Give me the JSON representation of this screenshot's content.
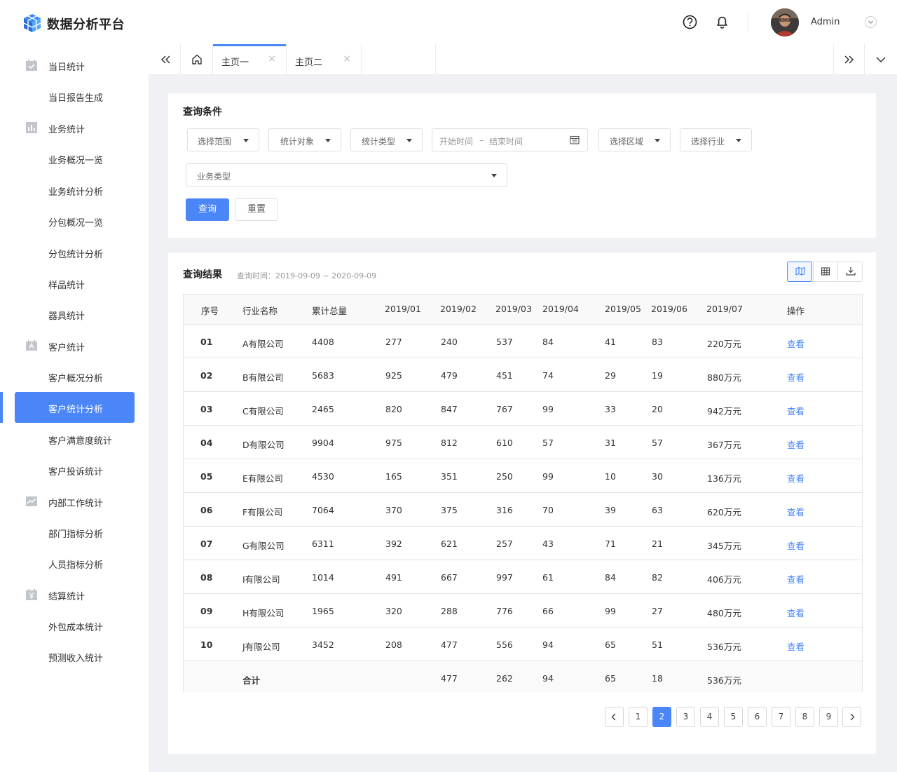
{
  "app": {
    "brand": "数据分析平台",
    "username": "Admin"
  },
  "sidebar": {
    "items": [
      {
        "label": "当日统计",
        "type": "group",
        "icon": "calendar-check-icon"
      },
      {
        "label": "当日报告生成",
        "type": "sub"
      },
      {
        "label": "业务统计",
        "type": "group",
        "icon": "bar-chart-icon"
      },
      {
        "label": "业务概况一览",
        "type": "sub"
      },
      {
        "label": "业务统计分析",
        "type": "sub"
      },
      {
        "label": "分包概况一览",
        "type": "sub"
      },
      {
        "label": "分包统计分析",
        "type": "sub"
      },
      {
        "label": "样品统计",
        "type": "sub"
      },
      {
        "label": "器具统计",
        "type": "sub"
      },
      {
        "label": "客户统计",
        "type": "group",
        "icon": "contact-card-icon"
      },
      {
        "label": "客户概况分析",
        "type": "sub"
      },
      {
        "label": "客户统计分析",
        "type": "sub",
        "active": true
      },
      {
        "label": "客户满意度统计",
        "type": "sub"
      },
      {
        "label": "客户投诉统计",
        "type": "sub"
      },
      {
        "label": "内部工作统计",
        "type": "group",
        "icon": "line-chart-icon"
      },
      {
        "label": "部门指标分析",
        "type": "sub"
      },
      {
        "label": "人员指标分析",
        "type": "sub"
      },
      {
        "label": "结算统计",
        "type": "group",
        "icon": "yen-calendar-icon"
      },
      {
        "label": "外包成本统计",
        "type": "sub"
      },
      {
        "label": "预测收入统计",
        "type": "sub"
      }
    ]
  },
  "tabs": [
    {
      "label": "主页一",
      "active": true
    },
    {
      "label": "主页二",
      "active": false
    }
  ],
  "query": {
    "title": "查询条件",
    "filters": {
      "scope": "选择范围",
      "target": "统计对象",
      "stat_type": "统计类型",
      "start": "开始时间",
      "range_sep": "–",
      "end": "结束时间",
      "region": "选择区域",
      "industry": "选择行业",
      "biz_type": "业务类型"
    },
    "buttons": {
      "search": "查询",
      "reset": "重置"
    }
  },
  "results": {
    "title": "查询结果",
    "time_label": "查询时间：2019-09-09 ~ 2020-09-09",
    "columns": [
      "序号",
      "行业名称",
      "累计总量",
      "2019/01",
      "2019/02",
      "2019/03",
      "2019/04",
      "2019/05",
      "2019/06",
      "2019/07",
      "操作"
    ],
    "rows": [
      [
        "01",
        "A有限公司",
        "4408",
        "277",
        "240",
        "537",
        "84",
        "41",
        "83",
        "220万元",
        "查看"
      ],
      [
        "02",
        "B有限公司",
        "5683",
        "925",
        "479",
        "451",
        "74",
        "29",
        "19",
        "880万元",
        "查看"
      ],
      [
        "03",
        "C有限公司",
        "2465",
        "820",
        "847",
        "767",
        "99",
        "33",
        "20",
        "942万元",
        "查看"
      ],
      [
        "04",
        "D有限公司",
        "9904",
        "975",
        "812",
        "610",
        "57",
        "31",
        "57",
        "367万元",
        "查看"
      ],
      [
        "05",
        "E有限公司",
        "4530",
        "165",
        "351",
        "250",
        "99",
        "10",
        "30",
        "136万元",
        "查看"
      ],
      [
        "06",
        "F有限公司",
        "7064",
        "370",
        "375",
        "316",
        "70",
        "39",
        "63",
        "620万元",
        "查看"
      ],
      [
        "07",
        "G有限公司",
        "6311",
        "392",
        "621",
        "257",
        "43",
        "71",
        "21",
        "345万元",
        "查看"
      ],
      [
        "08",
        "I有限公司",
        "1014",
        "491",
        "667",
        "997",
        "61",
        "84",
        "82",
        "406万元",
        "查看"
      ],
      [
        "09",
        "H有限公司",
        "1965",
        "320",
        "288",
        "776",
        "66",
        "99",
        "27",
        "480万元",
        "查看"
      ],
      [
        "10",
        "J有限公司",
        "3452",
        "208",
        "477",
        "556",
        "94",
        "65",
        "51",
        "536万元",
        "查看"
      ]
    ],
    "total": {
      "label": "合计",
      "m2": "477",
      "m3": "262",
      "m4": "94",
      "m5": "65",
      "m6": "18",
      "m7": "536万元"
    }
  },
  "pagination": {
    "pages": [
      "1",
      "2",
      "3",
      "4",
      "5",
      "6",
      "7",
      "8",
      "9"
    ],
    "current": "2"
  },
  "colors": {
    "primary": "#4a86f7",
    "content_bg": "#f0f1f4"
  }
}
